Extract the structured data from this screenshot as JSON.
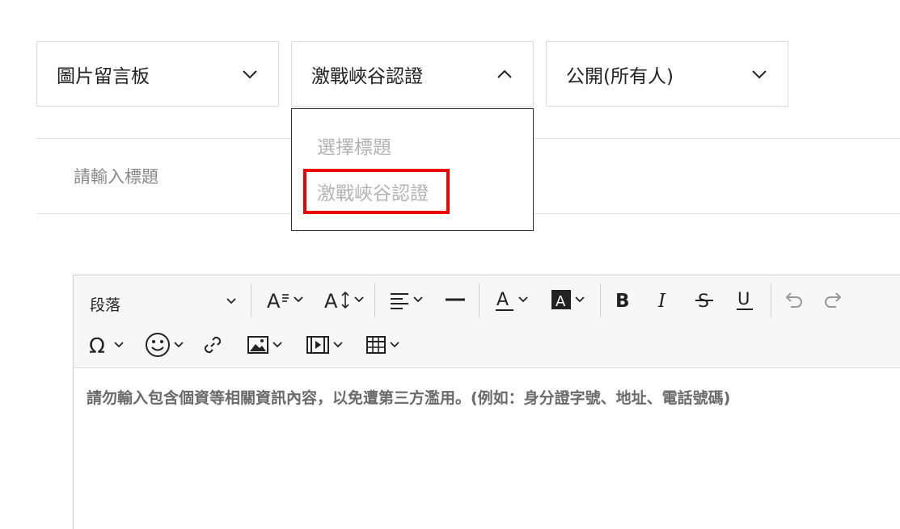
{
  "selects": {
    "board": {
      "value": "圖片留言板"
    },
    "category": {
      "value": "激戰峽谷認證",
      "open": true
    },
    "visibility": {
      "value": "公開(所有人)"
    }
  },
  "dropdown": {
    "options": [
      {
        "label": "選擇標題"
      },
      {
        "label": "激戰峽谷認證",
        "highlighted": true
      }
    ],
    "highlight_color": "#ee0000"
  },
  "title": {
    "placeholder": "請輸入標題",
    "value": ""
  },
  "editor": {
    "paragraph_label": "段落",
    "toolbar_icons": [
      "font-size-icon",
      "line-height-icon",
      "align-icon",
      "horizontal-line-icon",
      "font-color-icon",
      "background-color-icon",
      "bold-icon",
      "italic-icon",
      "strikethrough-icon",
      "underline-icon",
      "undo-icon",
      "redo-icon",
      "special-char-icon",
      "emoji-icon",
      "link-icon",
      "image-icon",
      "video-icon",
      "table-icon"
    ],
    "placeholder": "請勿輸入包含個資等相關資訊內容，以免遭第三方濫用。(例如：身分證字號、地址、電話號碼)"
  }
}
